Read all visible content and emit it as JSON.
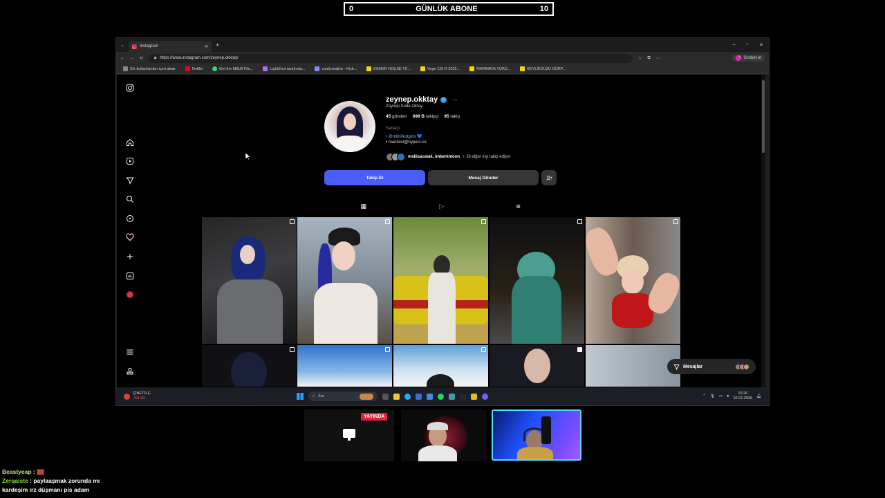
{
  "counter": {
    "left": "0",
    "title": "GÜNLÜK ABONE",
    "right": "10"
  },
  "browser": {
    "tab_title": "Instagram",
    "new_tab": "+",
    "url": "https://www.instagram.com/zeynep.okktay/",
    "chat_button": "Sohbet et",
    "window_controls": [
      "–",
      "▫",
      "✕"
    ],
    "bookmarks": [
      {
        "label": "Sık kullanılanları içeri aktar",
        "color": "#888"
      },
      {
        "label": "Netflix",
        "color": "#e50914"
      },
      {
        "label": "Get the M3U8 File...",
        "color": "#3ad37a"
      },
      {
        "label": "LightShot tarafında...",
        "color": "#b06cff"
      },
      {
        "label": "vaultcreative - Kick...",
        "color": "#8888ff"
      },
      {
        "label": "ESMER HOUSE TÜ...",
        "color": "#f5d60a"
      },
      {
        "label": "Voge 125 R 2025...",
        "color": "#f5d60a"
      },
      {
        "label": "MARINAYA YÜRÜ...",
        "color": "#f5d60a"
      },
      {
        "label": "BEYLİKDÜZÜ GÜRP...",
        "color": "#f5d60a"
      }
    ]
  },
  "sidebar": {
    "icons": [
      "instagram-logo-icon",
      "home-icon",
      "reels-icon",
      "messages-icon",
      "search-icon",
      "explore-icon",
      "notifications-icon",
      "create-icon",
      "dashboard-icon",
      "profile-icon",
      "menu-icon",
      "threads-icon"
    ]
  },
  "profile": {
    "username": "zeynep.okktay",
    "full_name": "Zeynep Sude Oktay",
    "posts_count": "45",
    "posts_label": "gönderi",
    "followers_count": "698 B",
    "followers_label": "takipçi",
    "following_count": "95",
    "following_label": "takip",
    "category": "Sanatçı",
    "bio_line1": "• @m6nifestgirls 💙",
    "bio_line2": "• manifest@hypers.co",
    "mutual_names": "meliisacatak, imberkmoon",
    "mutual_rest": "+ 26 diğer kişi takip ediyor",
    "follow_button": "Takip Et",
    "message_button": "Mesaj Gönder",
    "add_button": "+̳"
  },
  "messages_widget": {
    "label": "Mesajlar"
  },
  "taskbar": {
    "weather_title": "ÇİNETR.E",
    "weather_sub": "-%1.20",
    "search_placeholder": "Ara",
    "time": "10:26",
    "date": "10.02.2026"
  },
  "stream": {
    "live_badge": "YAYINDA"
  },
  "chat": [
    {
      "user": "Beastyeap",
      "message": ""
    },
    {
      "user": "Zerqaiste",
      "message": "paylaaşmak zorunda mı kardeşim ırz düşmanı pis adam"
    }
  ]
}
